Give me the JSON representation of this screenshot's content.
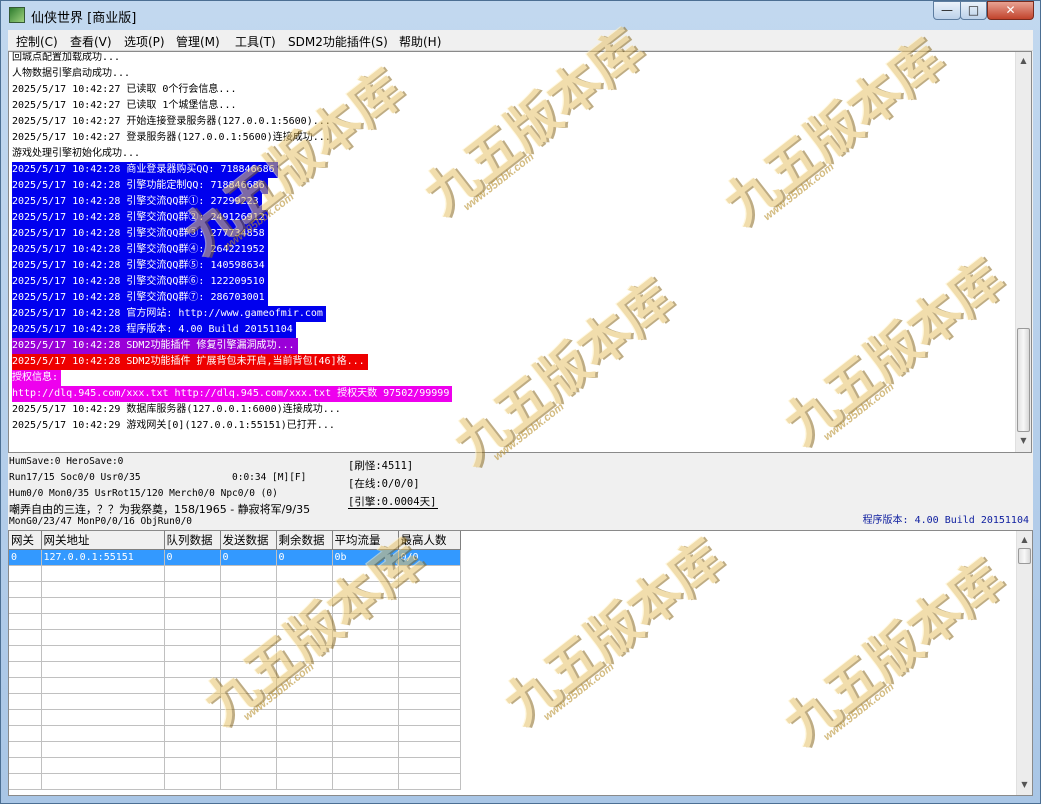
{
  "window": {
    "title": "仙侠世界 [商业版]",
    "minimize_glyph": "—",
    "maximize_glyph": "□",
    "close_glyph": "✕"
  },
  "menu": [
    {
      "label": "控制(C)"
    },
    {
      "label": "查看(V)"
    },
    {
      "label": "选项(P)"
    },
    {
      "label": "管理(M)"
    },
    {
      "label": "工具(T)"
    },
    {
      "label": "SDM2功能插件(S)"
    },
    {
      "label": "帮助(H)"
    }
  ],
  "log": {
    "lines": [
      {
        "text": "回城点配置加载成功...",
        "bg": "#ffffff",
        "fg": "#000000"
      },
      {
        "text": "人物数据引擎启动成功...",
        "bg": "#ffffff",
        "fg": "#000000"
      },
      {
        "text": "2025/5/17 10:42:27 已读取 0个行会信息...",
        "bg": "#ffffff",
        "fg": "#000000"
      },
      {
        "text": "2025/5/17 10:42:27 已读取 1个城堡信息...",
        "bg": "#ffffff",
        "fg": "#000000"
      },
      {
        "text": "2025/5/17 10:42:27 开始连接登录服务器(127.0.0.1:5600)...",
        "bg": "#ffffff",
        "fg": "#000000"
      },
      {
        "text": "2025/5/17 10:42:27 登录服务器(127.0.0.1:5600)连接成功...",
        "bg": "#ffffff",
        "fg": "#000000"
      },
      {
        "text": "游戏处理引擎初始化成功...",
        "bg": "#ffffff",
        "fg": "#000000"
      },
      {
        "text": "2025/5/17 10:42:28 商业登录器购买QQ: 718846686",
        "bg": "#0000ee",
        "fg": "#ffffff"
      },
      {
        "text": "2025/5/17 10:42:28 引擎功能定制QQ: 718846686",
        "bg": "#0000ee",
        "fg": "#ffffff"
      },
      {
        "text": "2025/5/17 10:42:28 引擎交流QQ群①: 27299223",
        "bg": "#0000ee",
        "fg": "#ffffff"
      },
      {
        "text": "2025/5/17 10:42:28 引擎交流QQ群②: 249126912",
        "bg": "#0000ee",
        "fg": "#ffffff"
      },
      {
        "text": "2025/5/17 10:42:28 引擎交流QQ群③: 277734858",
        "bg": "#0000ee",
        "fg": "#ffffff"
      },
      {
        "text": "2025/5/17 10:42:28 引擎交流QQ群④: 264221952",
        "bg": "#0000ee",
        "fg": "#ffffff"
      },
      {
        "text": "2025/5/17 10:42:28 引擎交流QQ群⑤: 140598634",
        "bg": "#0000ee",
        "fg": "#ffffff"
      },
      {
        "text": "2025/5/17 10:42:28 引擎交流QQ群⑥: 122209510",
        "bg": "#0000ee",
        "fg": "#ffffff"
      },
      {
        "text": "2025/5/17 10:42:28 引擎交流QQ群⑦: 286703001",
        "bg": "#0000ee",
        "fg": "#ffffff"
      },
      {
        "text": "2025/5/17 10:42:28 官方网站: http://www.gameofmir.com",
        "bg": "#0000ee",
        "fg": "#ffffff"
      },
      {
        "text": "2025/5/17 10:42:28 程序版本: 4.00 Build 20151104",
        "bg": "#0000ee",
        "fg": "#ffffff"
      },
      {
        "text": "2025/5/17 10:42:28 SDM2功能插件 修复引擎漏洞成功...",
        "bg": "#9a00d8",
        "fg": "#ffffff"
      },
      {
        "text": "2025/5/17 10:42:28 SDM2功能插件 扩展背包未开启,当前背包[46]格...",
        "bg": "#ee0000",
        "fg": "#ffffff"
      },
      {
        "text": "授权信息:",
        "bg": "#ee00ee",
        "fg": "#ffffff"
      },
      {
        "text": "http://dlq.945.com/xxx.txt http://dlq.945.com/xxx.txt 授权天数 97502/99999",
        "bg": "#ee00ee",
        "fg": "#ffffff"
      },
      {
        "text": "2025/5/17 10:42:29 数据库服务器(127.0.0.1:6000)连接成功...",
        "bg": "#ffffff",
        "fg": "#000000"
      },
      {
        "text": "2025/5/17 10:42:29 游戏网关[0](127.0.0.1:55151)已打开...",
        "bg": "#ffffff",
        "fg": "#000000"
      }
    ]
  },
  "status": {
    "line1": "HumSave:0 HeroSave:0",
    "line2": "Run17/15 Soc0/0 Usr0/35",
    "runtime": "0:0:34 [M][F]",
    "line3": "Hum0/0 Mon0/35 UsrRot15/120 Merch0/0 Npc0/0 (0)",
    "line4": "嘲弄自由的三连，？？为我祭奠，158/1965 - 静寂将军/9/35",
    "line5": "MonG0/23/47 MonP0/0/16 ObjRun0/0",
    "refresh_monsters": "[刷怪:4511]",
    "online": "[在线:0/0/0]",
    "engine": "[引擎:0.0004天]",
    "version": "程序版本: 4.00 Build 20151104"
  },
  "gate_table": {
    "columns": [
      "网关",
      "网关地址",
      "队列数据",
      "发送数据",
      "剩余数据",
      "平均流量",
      "最高人数"
    ],
    "rows": [
      [
        "0",
        "127.0.0.1:55151",
        "0",
        "0",
        "0",
        "0b",
        "0/0"
      ]
    ]
  },
  "watermark": {
    "main": "九五版本库",
    "sub": "www.95bbk.com"
  }
}
